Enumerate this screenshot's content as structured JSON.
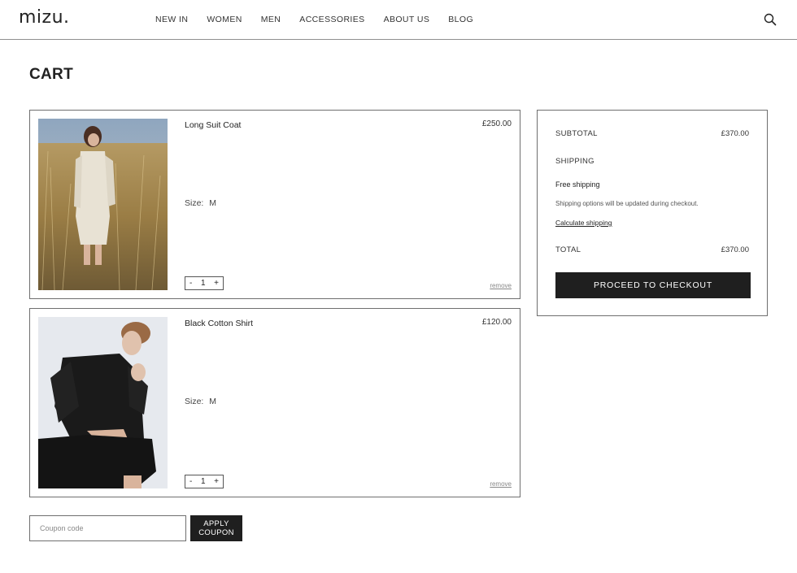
{
  "header": {
    "logo": "mizu.",
    "nav": [
      "NEW IN",
      "WOMEN",
      "MEN",
      "ACCESSORIES",
      "ABOUT US",
      "BLOG"
    ],
    "search_icon": "search-icon"
  },
  "page": {
    "title": "CART"
  },
  "cart": {
    "items": [
      {
        "name": "Long Suit Coat",
        "price": "£250.00",
        "size_label": "Size:",
        "size": "M",
        "qty_minus": "-",
        "qty": "1",
        "qty_plus": "+",
        "remove": "remove"
      },
      {
        "name": "Black Cotton Shirt",
        "price": "£120.00",
        "size_label": "Size:",
        "size": "M",
        "qty_minus": "-",
        "qty": "1",
        "qty_plus": "+",
        "remove": "remove"
      }
    ]
  },
  "coupon": {
    "placeholder": "Coupon code",
    "button_line1": "APPLY",
    "button_line2": "COUPON"
  },
  "summary": {
    "subtotal_label": "SUBTOTAL",
    "subtotal_value": "£370.00",
    "shipping_label": "SHIPPING",
    "free_shipping": "Free shipping",
    "shipping_note": "Shipping options will be updated during checkout.",
    "calculate_shipping": "Calculate shipping",
    "total_label": "TOTAL",
    "total_value": "£370.00",
    "checkout_button": "PROCEED TO CHECKOUT"
  },
  "colors": {
    "text": "#1f1f1f",
    "button_bg": "#1f1f1f",
    "border": "#6f6f6f",
    "background": "#ffffff"
  }
}
